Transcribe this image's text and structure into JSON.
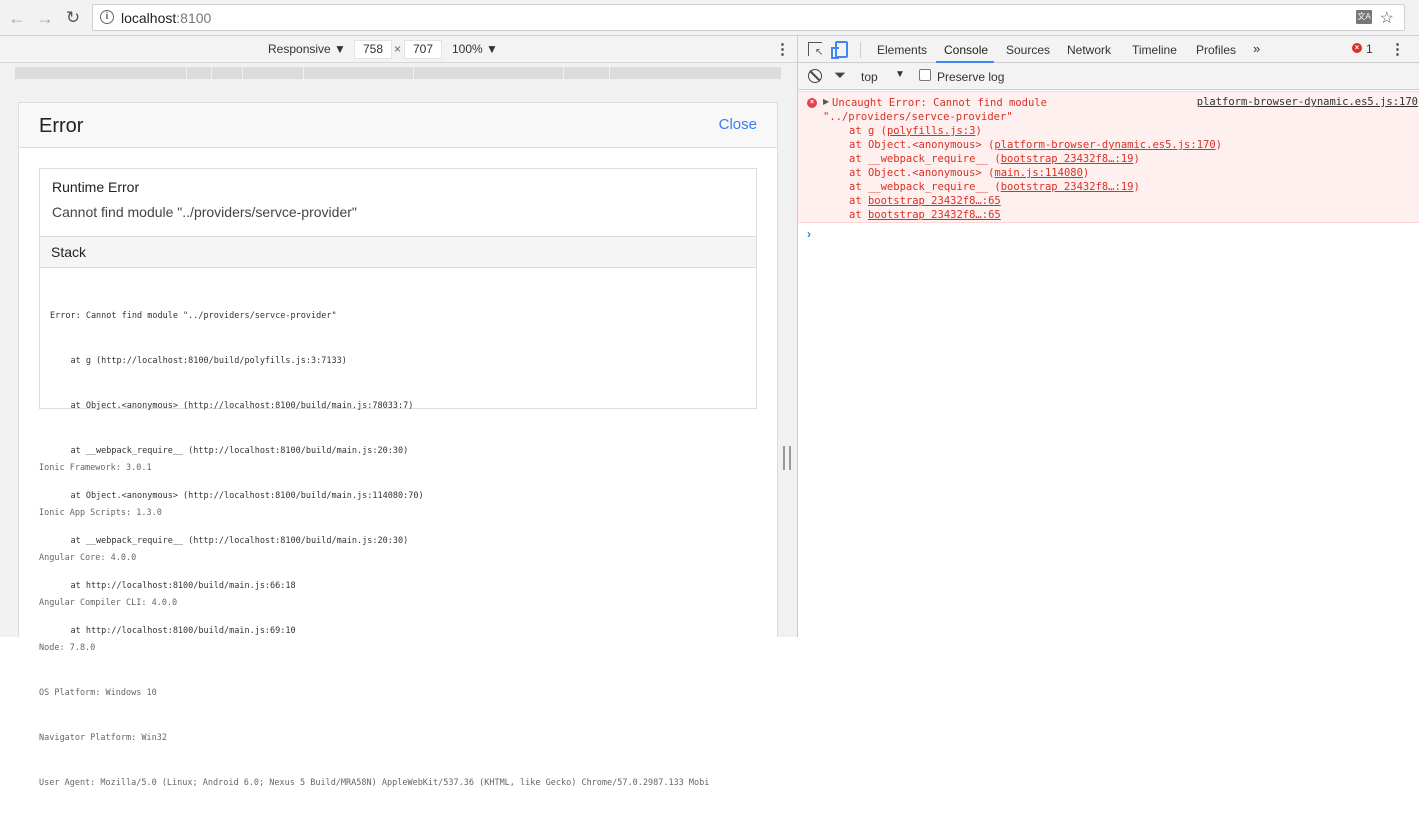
{
  "browser": {
    "url_host": "localhost",
    "url_port": ":8100"
  },
  "device_toolbar": {
    "mode": "Responsive",
    "width": "758",
    "times": "×",
    "height": "707",
    "zoom": "100%"
  },
  "error_page": {
    "title": "Error",
    "close_label": "Close",
    "runtime_title": "Runtime Error",
    "runtime_message": "Cannot find module \"../providers/servce-provider\"",
    "stack_title": "Stack",
    "stack_lines": [
      "Error: Cannot find module \"../providers/servce-provider\"",
      "    at g (http://localhost:8100/build/polyfills.js:3:7133)",
      "    at Object.<anonymous> (http://localhost:8100/build/main.js:78033:7)",
      "    at __webpack_require__ (http://localhost:8100/build/main.js:20:30)",
      "    at Object.<anonymous> (http://localhost:8100/build/main.js:114080:70)",
      "    at __webpack_require__ (http://localhost:8100/build/main.js:20:30)",
      "    at http://localhost:8100/build/main.js:66:18",
      "    at http://localhost:8100/build/main.js:69:10"
    ],
    "env_lines": [
      "Ionic Framework: 3.0.1",
      "Ionic App Scripts: 1.3.0",
      "Angular Core: 4.0.0",
      "Angular Compiler CLI: 4.0.0",
      "Node: 7.8.0",
      "OS Platform: Windows 10",
      "Navigator Platform: Win32",
      "User Agent: Mozilla/5.0 (Linux; Android 6.0; Nexus 5 Build/MRA58N) AppleWebKit/537.36 (KHTML, like Gecko) Chrome/57.0.2987.133 Mobi"
    ]
  },
  "devtools": {
    "tabs": [
      "Elements",
      "Console",
      "Sources",
      "Network",
      "Timeline",
      "Profiles"
    ],
    "active_tab": "Console",
    "more_tabs": "»",
    "error_count": "1",
    "context": "top",
    "preserve_log_label": "Preserve log",
    "console": {
      "error_line1": "Uncaught Error: Cannot find module",
      "error_line2": "\"../providers/servce-provider\"",
      "source_link": "platform-browser-dynamic.es5.js:170",
      "trace": [
        {
          "prefix": "at g (",
          "link": "polyfills.js:3",
          "suffix": ")"
        },
        {
          "prefix": "at Object.<anonymous> (",
          "link": "platform-browser-dynamic.es5.js:170",
          "suffix": ")"
        },
        {
          "prefix": "at __webpack_require__ (",
          "link": "bootstrap 23432f8…:19",
          "suffix": ")"
        },
        {
          "prefix": "at Object.<anonymous> (",
          "link": "main.js:114080",
          "suffix": ")"
        },
        {
          "prefix": "at __webpack_require__ (",
          "link": "bootstrap 23432f8…:19",
          "suffix": ")"
        },
        {
          "prefix": "at ",
          "link": "bootstrap 23432f8…:65",
          "suffix": ""
        },
        {
          "prefix": "at ",
          "link": "bootstrap 23432f8…:65",
          "suffix": ""
        }
      ],
      "prompt": "›"
    }
  },
  "colors": {
    "accent": "#387ef5",
    "devtools_blue": "#4285f4",
    "error_red": "#d93025",
    "error_bg": "#fff0f0"
  }
}
